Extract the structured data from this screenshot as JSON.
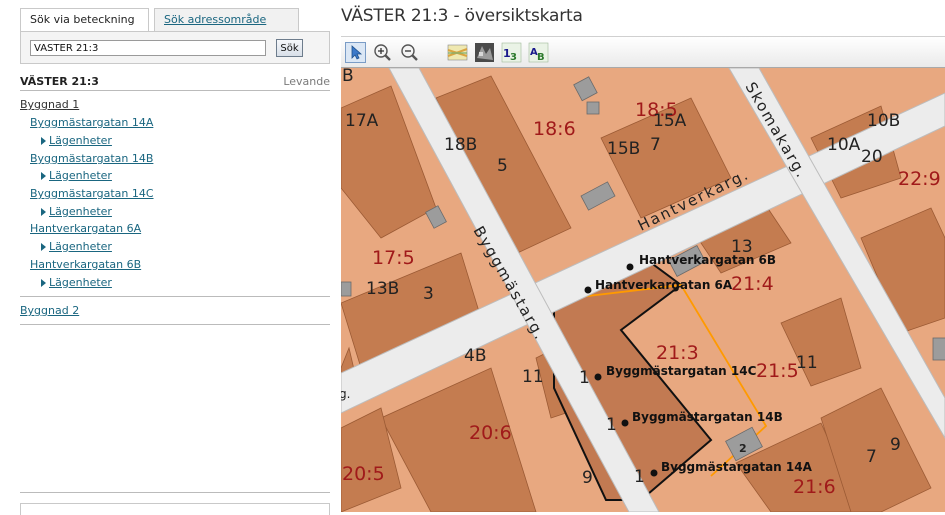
{
  "search": {
    "tabs": [
      {
        "label": "Sök via beteckning",
        "active": true
      },
      {
        "label": "Sök adressområde",
        "active": false
      }
    ],
    "query": "VÄSTER 21:3",
    "button": "Sök"
  },
  "property": {
    "title": "VÄSTER 21:3",
    "status": "Levande"
  },
  "tree": {
    "building1": "Byggnad 1",
    "addresses": [
      {
        "label": "Byggmästargatan 14A",
        "sub": "Lägenheter"
      },
      {
        "label": "Byggmästargatan 14B",
        "sub": "Lägenheter"
      },
      {
        "label": "Byggmästargatan 14C",
        "sub": "Lägenheter"
      },
      {
        "label": "Hantverkargatan 6A",
        "sub": "Lägenheter"
      },
      {
        "label": "Hantverkargatan 6B",
        "sub": "Lägenheter"
      }
    ],
    "building2": "Byggnad 2"
  },
  "map": {
    "title": "VÄSTER 21:3 - översiktskarta",
    "toolbar": [
      "select-arrow-icon",
      "zoom-in-icon",
      "zoom-out-icon",
      "map-layer-icon",
      "aerial-photo-icon",
      "number-labels-icon",
      "text-labels-icon"
    ],
    "streets": [
      "Hantverkarg.",
      "Byggmästarg.",
      "Skomakarg."
    ],
    "parcels": [
      "18:5",
      "18:6",
      "17:5",
      "21:4",
      "21:3",
      "21:5",
      "20:6",
      "20:5",
      "21:6",
      "22:9"
    ],
    "house_numbers": [
      "B",
      "17A",
      "18B",
      "5",
      "15B",
      "7",
      "15A",
      "10A",
      "20",
      "10B",
      "13",
      "13B",
      "3",
      "4B",
      "11",
      "11",
      "9",
      "9",
      "7",
      "1",
      "1",
      "1",
      "2"
    ],
    "address_points": [
      "Hantverkargatan 6B",
      "Hantverkargatan 6A",
      "Byggmästargatan 14C",
      "Byggmästargatan 14B",
      "Byggmästargatan 14A"
    ],
    "colors": {
      "parcel": "#e8a880",
      "building": "#c47c50",
      "street": "#ececec",
      "selected_parcel": "#c27a52",
      "parcel_label": "#a01a1a",
      "orange_line": "#ff9a00"
    }
  }
}
